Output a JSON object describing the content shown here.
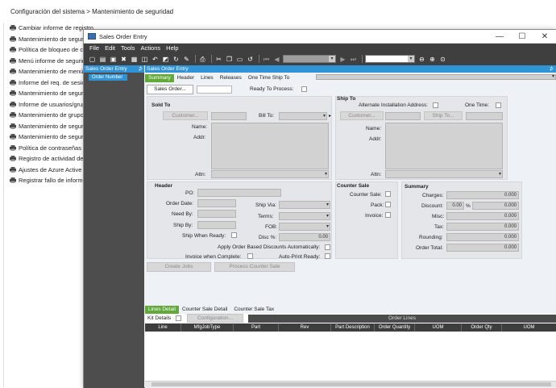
{
  "background": {
    "breadcrumb": "Configuración del sistema > Mantenimiento de seguridad",
    "items": [
      "Cambiar informe de registro",
      "Mantenimiento de seguridad",
      "Política de bloqueo de cuenta",
      "Menú informe de seguridad",
      "Mantenimiento de menú",
      "Informe del req. de sesión",
      "Mantenimiento de seguridad",
      "Informe de usuarios/grupos",
      "Mantenimiento de grupos",
      "Mantenimiento de seguridad",
      "Mantenimiento de seguridad",
      "Política de contraseñas",
      "Registro de actividad del usuario",
      "Ajustes de Azure Active Directory",
      "Registrar fallo de informe"
    ]
  },
  "window": {
    "title": "Sales Order Entry",
    "controls": {
      "minimize": "—",
      "maximize": "☐",
      "close": "✕"
    },
    "menu": [
      "File",
      "Edit",
      "Tools",
      "Actions",
      "Help"
    ]
  },
  "tree": {
    "header": "Sales Order Entry",
    "node": "Order Number"
  },
  "main": {
    "header": "Sales Order Entry",
    "tabs": [
      "Summary",
      "Header",
      "Lines",
      "Releases",
      "One Time Ship To"
    ],
    "active_tab": "Summary",
    "sales_order_button": "Sales Order...",
    "ready_to_process": "Ready To Process:",
    "sold_to": {
      "title": "Sold To",
      "customer_button": "Customer...",
      "bill_to": "Bill To:",
      "name": "Name:",
      "addr": "Addr:",
      "attn": "Attn:"
    },
    "ship_to": {
      "title": "Ship To",
      "alt_address": "Alternate Installation Address:",
      "one_time": "One Time:",
      "customer_button": "Customer...",
      "ship_to_button": "Ship To...",
      "name": "Name:",
      "addr": "Addr:",
      "attn": "Attn:"
    },
    "header_section": {
      "title": "Header",
      "po": "PO:",
      "order_date": "Order Date:",
      "need_by": "Need By:",
      "ship_by": "Ship By:",
      "ship_when_ready": "Ship When Ready:",
      "ship_via": "Ship Via:",
      "terms": "Terms:",
      "fob": "FOB:",
      "disc_pct": "Disc %:",
      "disc_value": "0.00",
      "apply_discounts": "Apply Order Based Discounts Automatically:",
      "invoice_when_complete": "Invoice when Complete:",
      "auto_print_ready": "Auto-Print Ready:"
    },
    "counter_sale": {
      "title": "Counter Sale",
      "counter_sale": "Counter Sale:",
      "pack": "Pack:",
      "invoice": "Invoice:"
    },
    "summary": {
      "title": "Summary",
      "charges": "Charges:",
      "charges_value": "0.000",
      "discount": "Discount:",
      "discount_pct": "0.00",
      "pct_sign": "%",
      "discount_value": "0.000",
      "misc": "Misc:",
      "misc_value": "0.000",
      "tax": "Tax:",
      "tax_value": "0.000",
      "rounding": "Rounding:",
      "rounding_value": "0.000",
      "order_total": "Order Total:",
      "order_total_value": "0.000"
    },
    "create_jobs": "Create Jobs",
    "process_counter_sale": "Process Counter Sale",
    "lines_tabs": [
      "Lines Detail",
      "Counter Sale Detail",
      "Counter Sale Tax"
    ],
    "kit_details": "Kit Details",
    "configuration": "Configuration...",
    "order_lines": "Order Lines",
    "columns": [
      "Line",
      "MfgJobType",
      "Part",
      "Rev",
      "Part Description",
      "Order Quantity",
      "UOM",
      "Order Qty",
      "UOM"
    ]
  }
}
